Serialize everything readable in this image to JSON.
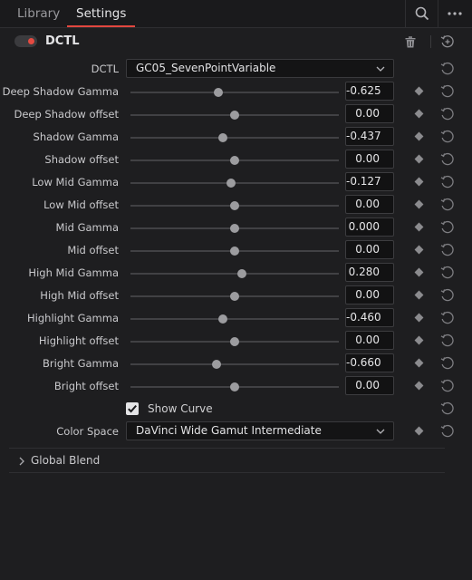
{
  "tabs": [
    {
      "label": "Library"
    },
    {
      "label": "Settings"
    }
  ],
  "top_icons": {
    "search": "search-icon",
    "more": "more-horizontal-icon"
  },
  "effect": {
    "title": "DCTL",
    "enabled": true,
    "accent_color": "#e54a41"
  },
  "dctl": {
    "label": "DCTL",
    "value": "GC05_SevenPointVariable"
  },
  "params": [
    {
      "label": "Deep Shadow Gamma",
      "value": "-0.625",
      "position": 0.42
    },
    {
      "label": "Deep Shadow offset",
      "value": "0.00",
      "position": 0.5
    },
    {
      "label": "Shadow Gamma",
      "value": "-0.437",
      "position": 0.445
    },
    {
      "label": "Shadow offset",
      "value": "0.00",
      "position": 0.5
    },
    {
      "label": "Low Mid Gamma",
      "value": "-0.127",
      "position": 0.482
    },
    {
      "label": "Low Mid offset",
      "value": "0.00",
      "position": 0.5
    },
    {
      "label": "Mid Gamma",
      "value": "0.000",
      "position": 0.5
    },
    {
      "label": "Mid offset",
      "value": "0.00",
      "position": 0.5
    },
    {
      "label": "High Mid Gamma",
      "value": "0.280",
      "position": 0.535
    },
    {
      "label": "High Mid offset",
      "value": "0.00",
      "position": 0.5
    },
    {
      "label": "Highlight Gamma",
      "value": "-0.460",
      "position": 0.443
    },
    {
      "label": "Highlight offset",
      "value": "0.00",
      "position": 0.5
    },
    {
      "label": "Bright Gamma",
      "value": "-0.660",
      "position": 0.415
    },
    {
      "label": "Bright offset",
      "value": "0.00",
      "position": 0.5
    }
  ],
  "show_curve": {
    "label": "Show Curve",
    "checked": true
  },
  "color_space": {
    "label": "Color Space",
    "value": "DaVinci Wide Gamut Intermediate"
  },
  "global_blend": {
    "label": "Global Blend",
    "expanded": false
  }
}
